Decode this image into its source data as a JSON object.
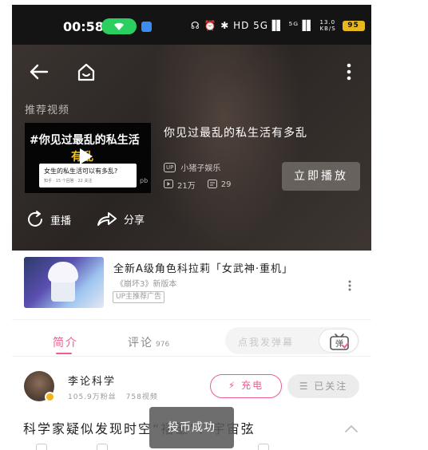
{
  "status_bar": {
    "time": "00:58",
    "network_speed": "13.0 KB/S",
    "icons_right": "☊ ⏰ ✱ HD 5G▐▌ ⁵ᴳ▐▌",
    "battery": "95"
  },
  "player": {
    "recommended_label": "推荐视频",
    "thumbnail": {
      "title": "#你见过最乱的私生活",
      "subtitle": "有乱",
      "card_question": "女生的私生活可以有多乱?",
      "card_meta": "知乎 · 15 个回答 · 22 关注",
      "extra": "pb"
    },
    "video_title": "你见过最乱的私生活有多乱",
    "uploader_badge": "UP",
    "uploader": "小猪子娱乐",
    "views": "21万",
    "danmaku_count": "29",
    "play_now": "立即播放",
    "replay": "重播",
    "share": "分享"
  },
  "promo": {
    "title": "全新A级角色科拉莉「女武神·重机」",
    "subtitle": "《崩坏3》新版本",
    "tag": "UP主推荐广告"
  },
  "tabs": {
    "intro": "简介",
    "comments": "评论",
    "comments_count": "976"
  },
  "danmaku_input": {
    "placeholder": "点我发弹幕",
    "button_label": "弹"
  },
  "uploader": {
    "name": "李论科学",
    "followers": "105.9万粉丝",
    "videos": "758视频",
    "charge_label": "充电",
    "follow_label": "已关注"
  },
  "video": {
    "title": "科学家疑似发现时空“褶皱”：宇宙弦"
  },
  "toast": {
    "text": "投币成功"
  },
  "colors": {
    "accent": "#f05d8a",
    "wifi": "#2bcf5f",
    "battery": "#e6b71e"
  }
}
